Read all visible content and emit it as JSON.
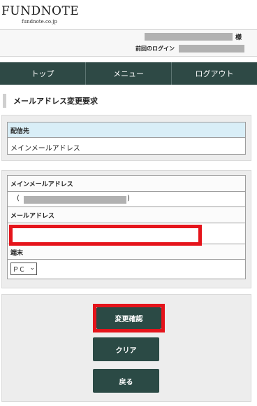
{
  "header": {
    "logo": "FUNDNOTE",
    "logo_sub": "fundnote.co.jp"
  },
  "user": {
    "honorific": "様",
    "last_login_label": "前回のログイン"
  },
  "nav": {
    "items": [
      "トップ",
      "メニュー",
      "ログアウト"
    ]
  },
  "page": {
    "title": "メールアドレス変更要求"
  },
  "delivery": {
    "header": "配信先",
    "value": "メインメールアドレス"
  },
  "form": {
    "main_mail_label": "メインメールアドレス",
    "paren_open": "(",
    "paren_close": ")",
    "email_label": "メールアドレス",
    "email_value": "",
    "device_label": "端末",
    "device_selected": "ＰＣ"
  },
  "buttons": {
    "confirm": "変更確認",
    "clear": "クリア",
    "back": "戻る"
  },
  "colors": {
    "nav_bg": "#2e4945",
    "button_bg": "#2b4a45",
    "highlight": "#e5141b",
    "delivery_header_bg": "#d9eef7"
  }
}
